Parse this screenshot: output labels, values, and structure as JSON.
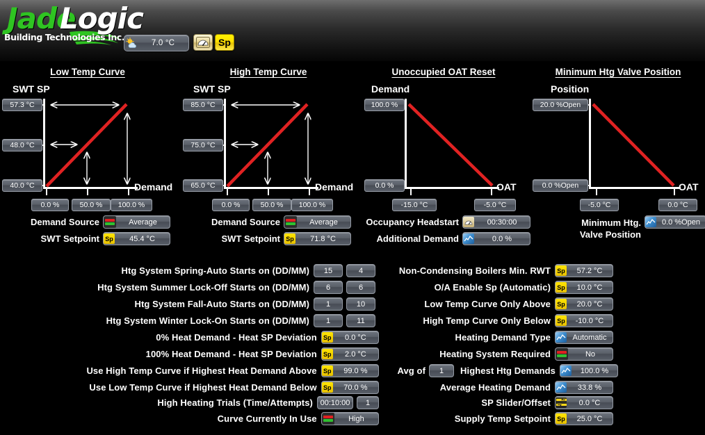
{
  "header": {
    "logo_jade": "Jade",
    "logo_logic": "Logic",
    "logo_sub": "Building Technologies Inc.",
    "outdoor_temp": "7.0 °C",
    "gauge_icon_label": "gauge",
    "sp_button_label": "Sp"
  },
  "charts": [
    {
      "title": "Low Temp Curve",
      "y_axis_label": "SWT SP",
      "x_axis_label": "Demand",
      "y_ticks": [
        "57.3 °C",
        "48.0 °C",
        "40.0 °C"
      ],
      "x_ticks": [
        "0.0 %",
        "50.0 %",
        "100.0 %"
      ],
      "fields": [
        {
          "label": "Demand Source",
          "icon": "red-green-bars-icon",
          "value": "Average"
        },
        {
          "label": "SWT Setpoint",
          "icon": "sp-icon",
          "value": "45.4 °C"
        }
      ]
    },
    {
      "title": "High Temp Curve",
      "y_axis_label": "SWT SP",
      "x_axis_label": "Demand",
      "y_ticks": [
        "85.0 °C",
        "75.0 °C",
        "65.0 °C"
      ],
      "x_ticks": [
        "0.0 %",
        "50.0 %",
        "100.0 %"
      ],
      "fields": [
        {
          "label": "Demand Source",
          "icon": "red-green-bars-icon",
          "value": "Average"
        },
        {
          "label": "SWT Setpoint",
          "icon": "sp-icon",
          "value": "71.8 °C"
        }
      ]
    },
    {
      "title": "Unoccupied OAT Reset",
      "y_axis_label": "Demand",
      "x_axis_label": "OAT",
      "y_ticks": [
        "100.0 %",
        "0.0 %"
      ],
      "x_ticks": [
        "-15.0 °C",
        "-5.0 °C"
      ],
      "fields": [
        {
          "label": "Occupancy Headstart",
          "icon": "gauge-icon",
          "value": "00:30:00"
        },
        {
          "label": "Additional Demand",
          "icon": "trend-icon",
          "value": "0.0 %"
        }
      ]
    },
    {
      "title": "Minimum Htg Valve Position",
      "y_axis_label": "Position",
      "x_axis_label": "OAT",
      "y_ticks": [
        "20.0 %Open",
        "0.0 %Open"
      ],
      "x_ticks": [
        "-5.0 °C",
        "0.0 °C"
      ],
      "fields": [
        {
          "label": "Minimum Htg.\nValve Position",
          "icon": "trend-icon",
          "value": "0.0 %Open"
        }
      ]
    }
  ],
  "chart_data": [
    {
      "type": "line",
      "title": "Low Temp Curve",
      "xlabel": "Demand",
      "ylabel": "SWT SP",
      "x": [
        0.0,
        100.0
      ],
      "y": [
        40.0,
        57.3
      ],
      "ytick_values": [
        57.3,
        48.0,
        40.0
      ],
      "ytick_labels": [
        "57.3 °C",
        "48.0 °C",
        "40.0 °C"
      ],
      "xtick_values": [
        0.0,
        50.0,
        100.0
      ],
      "xtick_labels": [
        "0.0 %",
        "50.0 %",
        "100.0 %"
      ],
      "ylim": [
        40.0,
        57.3
      ],
      "xlim": [
        0.0,
        100.0
      ],
      "grid": false,
      "legend": "none",
      "series_color": "#e02222"
    },
    {
      "type": "line",
      "title": "High Temp Curve",
      "xlabel": "Demand",
      "ylabel": "SWT SP",
      "x": [
        0.0,
        100.0
      ],
      "y": [
        65.0,
        85.0
      ],
      "ytick_values": [
        85.0,
        75.0,
        65.0
      ],
      "ytick_labels": [
        "85.0 °C",
        "75.0 °C",
        "65.0 °C"
      ],
      "xtick_values": [
        0.0,
        50.0,
        100.0
      ],
      "xtick_labels": [
        "0.0 %",
        "50.0 %",
        "100.0 %"
      ],
      "ylim": [
        65.0,
        85.0
      ],
      "xlim": [
        0.0,
        100.0
      ],
      "grid": false,
      "legend": "none",
      "series_color": "#e02222"
    },
    {
      "type": "line",
      "title": "Unoccupied OAT Reset",
      "xlabel": "OAT",
      "ylabel": "Demand",
      "x": [
        -15.0,
        -5.0
      ],
      "y": [
        100.0,
        0.0
      ],
      "ytick_values": [
        100.0,
        0.0
      ],
      "ytick_labels": [
        "100.0 %",
        "0.0 %"
      ],
      "xtick_values": [
        -15.0,
        -5.0
      ],
      "xtick_labels": [
        "-15.0 °C",
        "-5.0 °C"
      ],
      "ylim": [
        0.0,
        100.0
      ],
      "xlim": [
        -15.0,
        -5.0
      ],
      "grid": false,
      "legend": "none",
      "series_color": "#e02222"
    },
    {
      "type": "line",
      "title": "Minimum Htg Valve Position",
      "xlabel": "OAT",
      "ylabel": "Position",
      "x": [
        -5.0,
        0.0
      ],
      "y": [
        20.0,
        0.0
      ],
      "ytick_values": [
        20.0,
        0.0
      ],
      "ytick_labels": [
        "20.0 %Open",
        "0.0 %Open"
      ],
      "xtick_values": [
        -5.0,
        0.0
      ],
      "xtick_labels": [
        "-5.0 °C",
        "0.0 °C"
      ],
      "ylim": [
        0.0,
        20.0
      ],
      "xlim": [
        -5.0,
        0.0
      ],
      "grid": false,
      "legend": "none",
      "series_color": "#e02222"
    }
  ],
  "form_left": [
    {
      "label": "Htg System Spring-Auto Starts on (DD/MM)",
      "values": [
        "15",
        "4"
      ],
      "icon": "none"
    },
    {
      "label": "Htg System Summer Lock-Off Starts on (DD/MM)",
      "values": [
        "6",
        "6"
      ],
      "icon": "none"
    },
    {
      "label": "Htg System Fall-Auto Starts on (DD/MM)",
      "values": [
        "1",
        "10"
      ],
      "icon": "none"
    },
    {
      "label": "Htg System Winter Lock-On Starts on (DD/MM)",
      "values": [
        "1",
        "11"
      ],
      "icon": "none"
    },
    {
      "label": "0% Heat Demand - Heat SP Deviation",
      "values": [
        "0.0 °C"
      ],
      "icon": "sp-icon"
    },
    {
      "label": "100% Heat Demand - Heat SP Deviation",
      "values": [
        "2.0 °C"
      ],
      "icon": "sp-icon"
    },
    {
      "label": "Use High Temp Curve if Highest Heat Demand Above",
      "values": [
        "99.0 %"
      ],
      "icon": "sp-icon"
    },
    {
      "label": "Use Low Temp Curve if Highest Heat Demand Below",
      "values": [
        "70.0 %"
      ],
      "icon": "sp-icon"
    },
    {
      "label": "High Heating Trials (Time/Attempts)",
      "values": [
        "00:10:00",
        "1"
      ],
      "icon": "none"
    },
    {
      "label": "Curve Currently In Use",
      "values": [
        "High"
      ],
      "icon": "red-green-bars-icon"
    }
  ],
  "form_right": [
    {
      "label": "Non-Condensing Boilers Min. RWT",
      "value": "57.2 °C",
      "icon": "sp-icon"
    },
    {
      "label": "O/A Enable Sp (Automatic)",
      "value": "10.0 °C",
      "icon": "sp-icon"
    },
    {
      "label": "Low Temp Curve Only Above",
      "value": "20.0 °C",
      "icon": "sp-icon"
    },
    {
      "label": "High Temp Curve Only Below",
      "value": "-10.0 °C",
      "icon": "sp-icon"
    },
    {
      "label": "Heating Demand Type",
      "value": "Automatic",
      "icon": "trend-icon"
    },
    {
      "label": "Heating System Required",
      "value": "No",
      "icon": "red-green-bars-icon"
    },
    {
      "label": "Highest Htg Demands",
      "label_prefix": "Avg of",
      "inline_value": "1",
      "value": "100.0 %",
      "icon": "trend-icon"
    },
    {
      "label": "Average Heating Demand",
      "value": "33.8 %",
      "icon": "trend-icon"
    },
    {
      "label": "SP Slider/Offset",
      "value": "0.0 °C",
      "icon": "slider-icon"
    },
    {
      "label": "Supply Temp Setpoint",
      "value": "25.0 °C",
      "icon": "sp-icon"
    }
  ],
  "colors": {
    "curve": "#e02222",
    "accent_green": "#2fc422",
    "accent_yellow": "#ffe500",
    "axis": "#ffffff",
    "background": "#000000"
  }
}
